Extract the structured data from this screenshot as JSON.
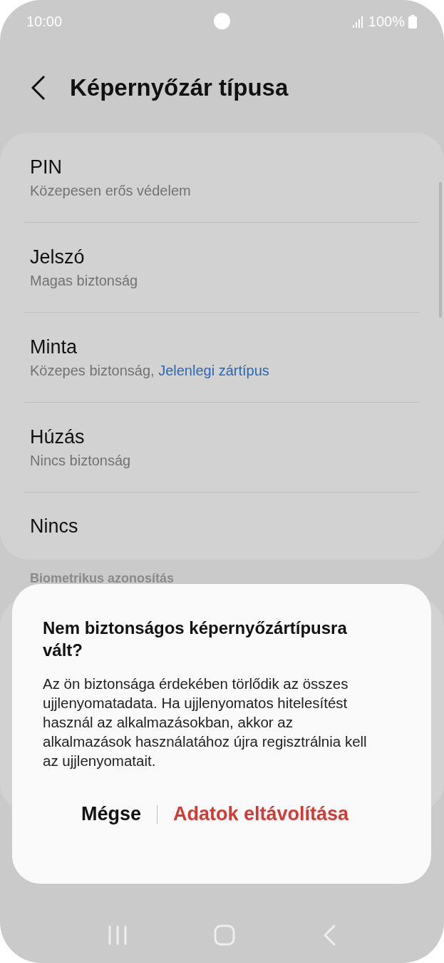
{
  "status_bar": {
    "time": "10:00",
    "battery": "100%"
  },
  "header": {
    "title": "Képernyőzár típusa"
  },
  "lock_types": [
    {
      "title": "PIN",
      "subtitle": "Közepesen erős védelem"
    },
    {
      "title": "Jelszó",
      "subtitle": "Magas biztonság"
    },
    {
      "title": "Minta",
      "subtitle": "Közepes biztonság,",
      "current_note": "Jelenlegi zártípus"
    },
    {
      "title": "Húzás",
      "subtitle": "Nincs biztonság"
    },
    {
      "title": "Nincs"
    }
  ],
  "section_label": "Biometrikus azonosítás",
  "dialog": {
    "title": "Nem biztonságos képernyőzártípusra vált?",
    "message": "Az ön biztonsága érdekében törlődik az összes ujjlenyomatadata. Ha ujjlenyomatos hitelesítést használ az alkalmazásokban, akkor az alkalmazások használatához újra regisztrálnia kell az ujjlenyomatait.",
    "buttons": [
      {
        "label": "Mégse",
        "kind": "neutral"
      },
      {
        "label": "Adatok eltávolítása",
        "kind": "destructive"
      }
    ]
  }
}
